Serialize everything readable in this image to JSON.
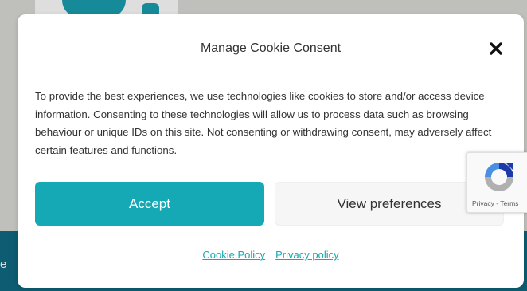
{
  "background": {
    "band_text": "e"
  },
  "modal": {
    "title": "Manage Cookie Consent",
    "message": "To provide the best experiences, we use technologies like cookies to store and/or access device information. Consenting to these technologies will allow us to process data such as browsing behaviour or unique IDs on this site. Not consenting or withdrawing consent, may adversely affect certain features and functions.",
    "accept_label": "Accept",
    "preferences_label": "View preferences",
    "links": {
      "cookie_policy": "Cookie Policy",
      "privacy_policy": "Privacy policy"
    }
  },
  "recaptcha": {
    "text": "Privacy - Terms"
  },
  "colors": {
    "accent": "#14a9b4",
    "band": "#0f6a82"
  }
}
